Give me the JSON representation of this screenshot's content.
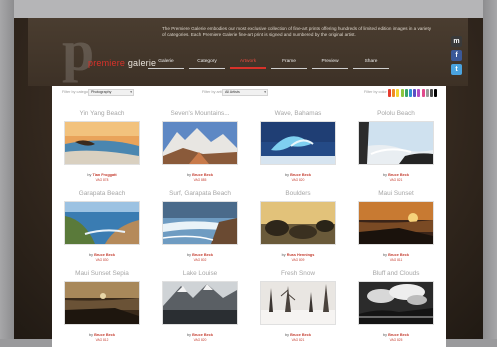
{
  "brand": {
    "logo_letter": "p",
    "name_prefix": "premiere",
    "name_suffix": "galerie"
  },
  "header": {
    "tagline": "The Premiere Galerie embodies our most exclusive collection of fine-art prints offering hundreds of limited edition images in a variety of categories. Each Premiere Galerie fine-art print is signed and numbered by the original artist."
  },
  "nav": {
    "items": [
      {
        "label": "Galerie",
        "active": false
      },
      {
        "label": "Category",
        "active": false
      },
      {
        "label": "Artwork",
        "active": true
      },
      {
        "label": "Frame",
        "active": false
      },
      {
        "label": "Preview",
        "active": false
      },
      {
        "label": "Share",
        "active": false
      }
    ]
  },
  "social": [
    {
      "icon": "myspace-icon",
      "glyph": "m",
      "color": "#3a3a3a"
    },
    {
      "icon": "facebook-icon",
      "glyph": "f",
      "color": "#3b5998"
    },
    {
      "icon": "twitter-icon",
      "glyph": "t",
      "color": "#4aa3df"
    }
  ],
  "filters": {
    "category_label": "Filter by category",
    "category_value": "Photography",
    "artist_label": "Filter by artist",
    "artist_value": "All Artists",
    "color_label": "Filter by color",
    "swatch_colors": [
      "#e63b2e",
      "#f08a24",
      "#f4d531",
      "#8cc63f",
      "#3aa56b",
      "#2f8fd6",
      "#5a4fc4",
      "#b14fc4",
      "#e04a8c",
      "#9a9a9a",
      "#4a4a4a",
      "#000000"
    ]
  },
  "gallery": {
    "by_prefix": "by",
    "items": [
      {
        "title": "Yin Yang Beach",
        "artist": "Tian Froggatt",
        "code": "VAG 878",
        "scene": "yinyang"
      },
      {
        "title": "Seven's Mountains...",
        "artist": "Bruce Beck",
        "code": "VAG 885",
        "scene": "mountains"
      },
      {
        "title": "Wave, Bahamas",
        "artist": "Bruce Beck",
        "code": "VAG 820",
        "scene": "wave"
      },
      {
        "title": "Pololu Beach",
        "artist": "Bruce Beck",
        "code": "VAG 821",
        "scene": "pololu"
      },
      {
        "title": "Garapata Beach",
        "artist": "Bruce Beck",
        "code": "VAG 830",
        "scene": "garapata"
      },
      {
        "title": "Surf, Garapata Beach",
        "artist": "Bruce Beck",
        "code": "VAG 802",
        "scene": "surf"
      },
      {
        "title": "Boulders",
        "artist": "Russ Hennings",
        "code": "VAG 809",
        "scene": "boulders"
      },
      {
        "title": "Maui Sunset",
        "artist": "Bruce Beck",
        "code": "VAG 811",
        "scene": "mauisunset"
      },
      {
        "title": "Maui Sunset Sepia",
        "artist": "Bruce Beck",
        "code": "VAG 812",
        "scene": "sepia"
      },
      {
        "title": "Lake Louise",
        "artist": "Bruce Beck",
        "code": "VAG 820",
        "scene": "lake"
      },
      {
        "title": "Fresh Snow",
        "artist": "Bruce Beck",
        "code": "VAG 821",
        "scene": "snow"
      },
      {
        "title": "Bluff and Clouds",
        "artist": "Bruce Beck",
        "code": "VAG 825",
        "scene": "bluff"
      }
    ]
  }
}
